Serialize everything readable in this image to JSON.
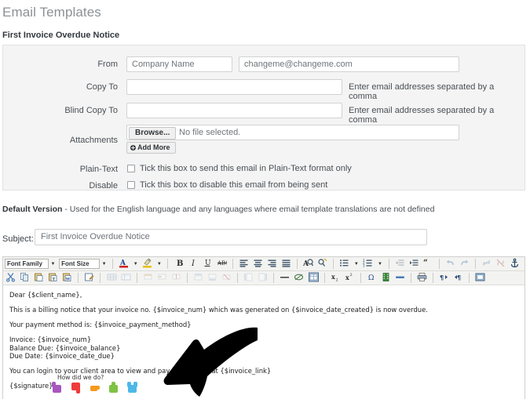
{
  "page": {
    "title": "Email Templates",
    "subtitle": "First Invoice Overdue Notice"
  },
  "form": {
    "rows": [
      {
        "label": "From",
        "value": "Company Name",
        "value2": "changeme@changeme.com",
        "hint": ""
      },
      {
        "label": "Copy To",
        "value": "",
        "hint": "Enter email addresses separated by a comma"
      },
      {
        "label": "Blind Copy To",
        "value": "",
        "hint": "Enter email addresses separated by a comma"
      }
    ],
    "attachments": {
      "label": "Attachments",
      "browse_label": "Browse...",
      "no_file_text": "No file selected.",
      "add_more_label": "Add More"
    },
    "plain_text": {
      "label": "Plain-Text",
      "checkbox_text": "Tick this box to send this email in Plain-Text format only",
      "checked": false
    },
    "disable": {
      "label": "Disable",
      "checkbox_text": "Tick this box to disable this email from being sent",
      "checked": false
    }
  },
  "default_version": {
    "bold": "Default Version",
    "rest": " - Used for the English language and any languages where email template translations are not defined"
  },
  "subject": {
    "label": "Subject:",
    "value": "First Invoice Overdue Notice",
    "placeholder": "Subject"
  },
  "editor": {
    "font_family_label": "Font Family",
    "font_size_label": "Font Size",
    "toolbar_row1": [
      "font-family-select",
      "font-size-select",
      "text-color-icon",
      "text-color-dropdown-icon",
      "background-color-icon",
      "background-color-dropdown-icon",
      "bold-icon",
      "italic-icon",
      "underline-icon",
      "strikethrough-icon",
      "align-left-icon",
      "align-center-icon",
      "align-right-icon",
      "align-justify-icon",
      "find-icon",
      "find-replace-icon",
      "bullet-list-icon",
      "bullet-list-dropdown-icon",
      "numbered-list-icon",
      "numbered-list-dropdown-icon",
      "outdent-icon",
      "indent-icon",
      "blockquote-icon",
      "undo-icon",
      "redo-icon",
      "link-icon",
      "unlink-icon",
      "anchor-icon",
      "image-icon",
      "cleanup-icon",
      "help-icon",
      "html-source-icon"
    ],
    "toolbar_row2": [
      "cut-icon",
      "copy-icon",
      "paste-icon",
      "paste-text-icon",
      "paste-word-icon",
      "edit-icon",
      "insert-table-icon",
      "table-properties-icon",
      "row-properties-icon",
      "cell-properties-icon",
      "merge-cells-icon",
      "insert-row-before-icon",
      "insert-row-after-icon",
      "delete-row-icon",
      "insert-column-before-icon",
      "insert-column-after-icon",
      "horizontal-rule-icon",
      "remove-format-icon",
      "visual-aid-icon",
      "subscript-icon",
      "superscript-icon",
      "special-character-icon",
      "insert-media-icon",
      "insert-date-icon",
      "print-icon",
      "ltr-icon",
      "rtl-icon",
      "fullscreen-icon"
    ],
    "content": {
      "greeting": "Dear {$client_name},",
      "paragraph1": "This is a billing notice that your invoice no. {$invoice_num} which was generated on {$invoice_date_created} is now overdue.",
      "paragraph2": "Your payment method is: {$invoice_payment_method}",
      "details": [
        "Invoice: {$invoice_num}",
        "Balance Due: {$invoice_balance}",
        "Due Date: {$invoice_date_due}"
      ],
      "paragraph3": "You can login to your client area to view and pay this invoice at {$invoice_link}",
      "signature": "{$signature}"
    }
  },
  "feedback": {
    "title": "How did we do?",
    "ratings": [
      {
        "name": "rating-awful",
        "color": "#a855c0"
      },
      {
        "name": "rating-bad",
        "color": "#ef3b3b"
      },
      {
        "name": "rating-ok",
        "color": "#f59a1e"
      },
      {
        "name": "rating-good",
        "color": "#7fc242"
      },
      {
        "name": "rating-great",
        "color": "#4db8e8"
      }
    ]
  },
  "annotation": {
    "name": "pointer-arrow",
    "color": "#000000"
  },
  "colors": {
    "panel_bg": "#f4f4f4",
    "panel_border": "#e2e2e2",
    "input_border": "#d2d2d2",
    "title": "#8c9196",
    "text": "#3a3f44",
    "toolbar_bg": "#f3f3f1"
  }
}
